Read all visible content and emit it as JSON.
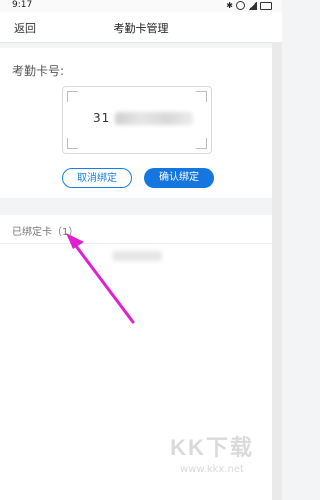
{
  "status": {
    "time": "9:17",
    "bluetooth_icon": "✱"
  },
  "nav": {
    "back_label": "返回",
    "title": "考勤卡管理"
  },
  "card": {
    "label": "考勤卡号:",
    "number_visible": "31",
    "unbind_label": "取消绑定",
    "confirm_label": "确认绑定"
  },
  "bound": {
    "label": "已绑定卡（1）"
  },
  "watermark": {
    "logo": "KK下载",
    "url": "www.kkx.net"
  },
  "colors": {
    "primary": "#1576e0",
    "arrow": "#e020d0"
  }
}
